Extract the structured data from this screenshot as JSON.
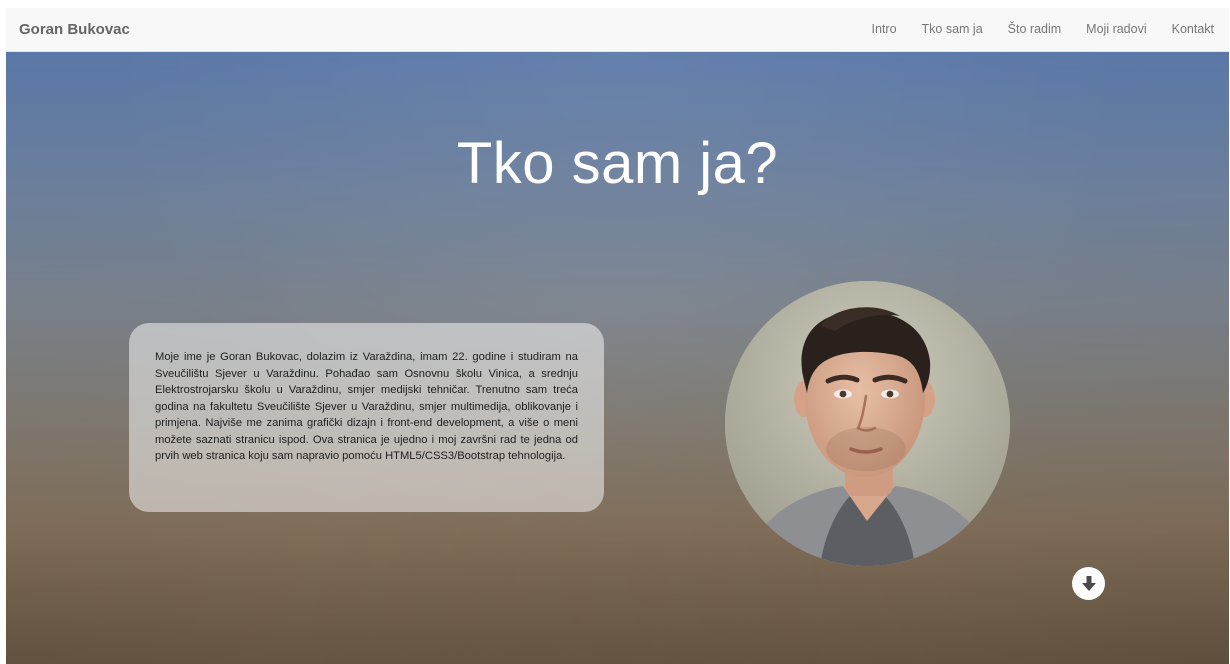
{
  "navbar": {
    "brand": "Goran Bukovac",
    "links": [
      {
        "label": "Intro"
      },
      {
        "label": "Tko sam ja"
      },
      {
        "label": "Što radim"
      },
      {
        "label": "Moji radovi"
      },
      {
        "label": "Kontakt"
      }
    ]
  },
  "hero": {
    "title": "Tko sam ja?",
    "bio": "Moje ime je Goran Bukovac, dolazim iz Varaždina, imam 22. godine i studiram na Sveučilištu Sjever u Varaždinu. Pohađao sam Osnovnu školu Vinica, a srednju Elektrostrojarsku školu u Varaždinu, smjer medijski tehničar. Trenutno sam treća godina na fakultetu Sveučilište Sjever u Varaždinu, smjer multimedija, oblikovanje i primjena. Najviše me zanima grafički dizajn i front-end development, a više o meni možete saznati stranicu ispod. Ova stranica je ujedno i moj završni rad te jedna od prvih web stranica koju sam napravio pomoću HTML5/CSS3/Bootstrap tehnologija.",
    "scroll_icon": "arrow-circle-down-icon"
  },
  "colors": {
    "navbar_bg": "#f8f8f8",
    "nav_text": "#777777",
    "brand_text": "#666666",
    "hero_top": "#5a78a8",
    "hero_bottom": "#6e5c46",
    "title_text": "#ffffff"
  }
}
